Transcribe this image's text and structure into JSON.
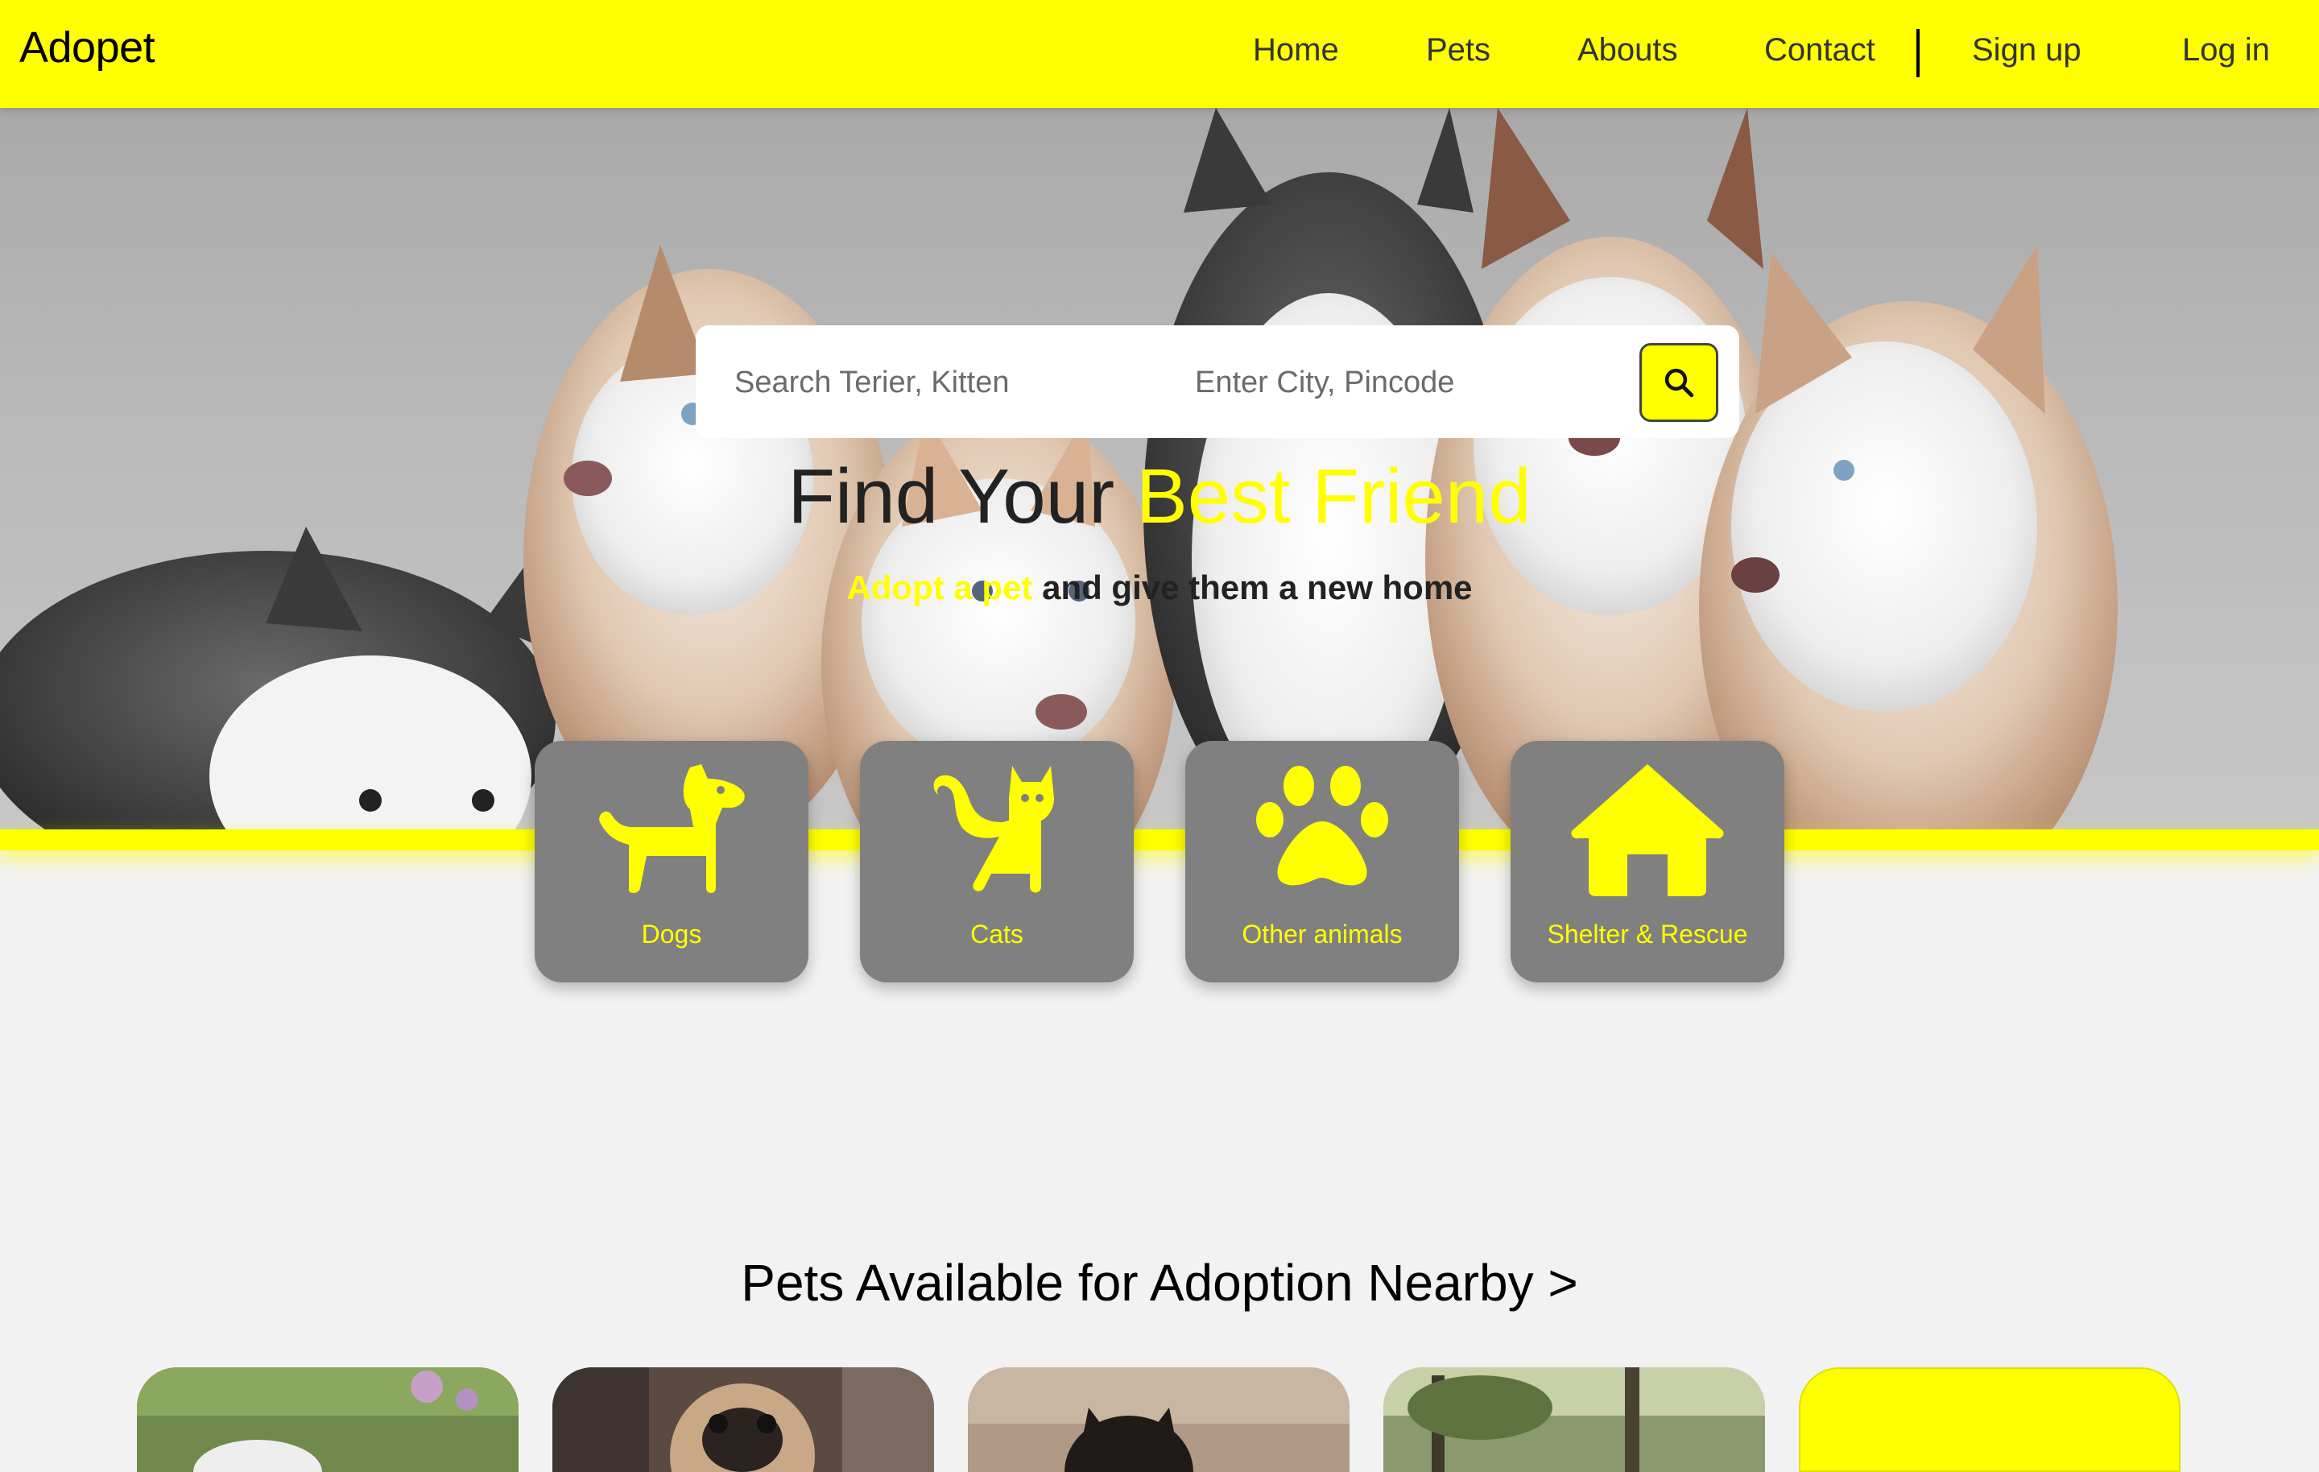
{
  "navbar": {
    "brand": "Adopet",
    "links": [
      {
        "label": "Home"
      },
      {
        "label": "Pets"
      },
      {
        "label": "Abouts"
      },
      {
        "label": "Contact"
      }
    ],
    "signup_label": "Sign up",
    "login_label": "Log in"
  },
  "search": {
    "pet_placeholder": "Search Terier, Kitten",
    "location_placeholder": "Enter City, Pincode",
    "button_icon": "search-icon"
  },
  "hero": {
    "title_plain": "Find Your ",
    "title_highlight": "Best Friend",
    "subtitle_highlight": "Adopt a pet",
    "subtitle_plain": " and give them a new home",
    "background": "husky puppies photo"
  },
  "categories": [
    {
      "label": "Dogs",
      "icon": "dog-icon"
    },
    {
      "label": "Cats",
      "icon": "cat-icon"
    },
    {
      "label": "Other animals",
      "icon": "paw-icon"
    },
    {
      "label": "Shelter & Rescue",
      "icon": "house-icon"
    }
  ],
  "nearby": {
    "title": "Pets Available for Adoption Nearby >",
    "cards": [
      {
        "image": "pet photo garden"
      },
      {
        "image": "pug photo"
      },
      {
        "image": "black dog photo"
      },
      {
        "image": "dog in park photo"
      },
      {
        "image": "yellow card"
      }
    ]
  },
  "colors": {
    "accent": "#ffff00",
    "card": "#808080",
    "background": "#f2f2f2",
    "text": "#222222"
  }
}
